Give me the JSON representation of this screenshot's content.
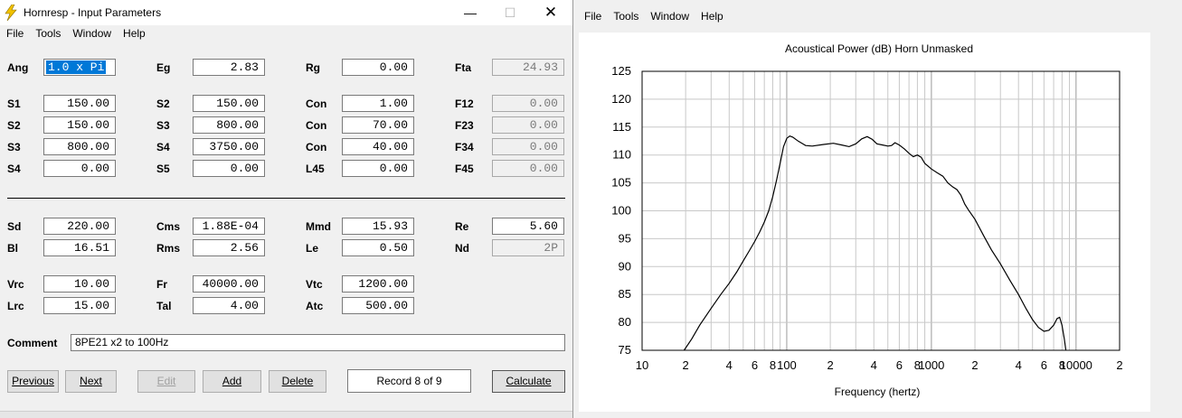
{
  "window": {
    "title": "Hornresp - Input Parameters",
    "minimize_glyph": "—",
    "maximize_glyph": "☐",
    "close_glyph": "✕"
  },
  "left_menu": [
    "File",
    "Tools",
    "Window",
    "Help"
  ],
  "right_menu": [
    "File",
    "Tools",
    "Window",
    "Help"
  ],
  "params": {
    "ang": {
      "label": "Ang",
      "value": "1.0 x Pi"
    },
    "eg": {
      "label": "Eg",
      "value": "2.83"
    },
    "rg": {
      "label": "Rg",
      "value": "0.00"
    },
    "fta": {
      "label": "Fta",
      "value": "24.93"
    },
    "s1": {
      "label": "S1",
      "value": "150.00"
    },
    "s2a": {
      "label": "S2",
      "value": "150.00"
    },
    "con1": {
      "label": "Con",
      "value": "1.00"
    },
    "f12": {
      "label": "F12",
      "value": "0.00"
    },
    "s2b": {
      "label": "S2",
      "value": "150.00"
    },
    "s3a": {
      "label": "S3",
      "value": "800.00"
    },
    "con2": {
      "label": "Con",
      "value": "70.00"
    },
    "f23": {
      "label": "F23",
      "value": "0.00"
    },
    "s3b": {
      "label": "S3",
      "value": "800.00"
    },
    "s4a": {
      "label": "S4",
      "value": "3750.00"
    },
    "con3": {
      "label": "Con",
      "value": "40.00"
    },
    "f34": {
      "label": "F34",
      "value": "0.00"
    },
    "s4b": {
      "label": "S4",
      "value": "0.00"
    },
    "s5": {
      "label": "S5",
      "value": "0.00"
    },
    "l45": {
      "label": "L45",
      "value": "0.00"
    },
    "f45": {
      "label": "F45",
      "value": "0.00"
    },
    "sd": {
      "label": "Sd",
      "value": "220.00"
    },
    "cms": {
      "label": "Cms",
      "value": "1.88E-04"
    },
    "mmd": {
      "label": "Mmd",
      "value": "15.93"
    },
    "re": {
      "label": "Re",
      "value": "5.60"
    },
    "bl": {
      "label": "Bl",
      "value": "16.51"
    },
    "rms": {
      "label": "Rms",
      "value": "2.56"
    },
    "le": {
      "label": "Le",
      "value": "0.50"
    },
    "nd": {
      "label": "Nd",
      "value": "2P"
    },
    "vrc": {
      "label": "Vrc",
      "value": "10.00"
    },
    "fr": {
      "label": "Fr",
      "value": "40000.00"
    },
    "vtc": {
      "label": "Vtc",
      "value": "1200.00"
    },
    "lrc": {
      "label": "Lrc",
      "value": "15.00"
    },
    "tal": {
      "label": "Tal",
      "value": "4.00"
    },
    "atc": {
      "label": "Atc",
      "value": "500.00"
    }
  },
  "comment": {
    "label": "Comment",
    "value": "8PE21 x2 to 100Hz"
  },
  "buttons": {
    "previous": "Previous",
    "next": "Next",
    "edit": "Edit",
    "add": "Add",
    "delete": "Delete",
    "calculate": "Calculate"
  },
  "record": "Record 8 of 9",
  "colors": {
    "selection": "#0078d7",
    "curve": "#000000",
    "grid": "#c8c8c8"
  },
  "chart_data": {
    "type": "line",
    "title": "Acoustical Power (dB)   Horn   Unmasked",
    "xlabel": "Frequency (hertz)",
    "ylabel": "",
    "xscale": "log",
    "xlim": [
      10,
      20000
    ],
    "ylim": [
      75,
      125
    ],
    "yticks": [
      75,
      80,
      85,
      90,
      95,
      100,
      105,
      110,
      115,
      120,
      125
    ],
    "xtick_labels": [
      {
        "v": 10,
        "t": "10"
      },
      {
        "v": 20,
        "t": "2"
      },
      {
        "v": 40,
        "t": "4"
      },
      {
        "v": 60,
        "t": "6"
      },
      {
        "v": 80,
        "t": "8"
      },
      {
        "v": 100,
        "t": "100"
      },
      {
        "v": 200,
        "t": "2"
      },
      {
        "v": 400,
        "t": "4"
      },
      {
        "v": 600,
        "t": "6"
      },
      {
        "v": 800,
        "t": "8"
      },
      {
        "v": 1000,
        "t": "1000"
      },
      {
        "v": 2000,
        "t": "2"
      },
      {
        "v": 4000,
        "t": "4"
      },
      {
        "v": 6000,
        "t": "6"
      },
      {
        "v": 8000,
        "t": "8"
      },
      {
        "v": 10000,
        "t": "10000"
      },
      {
        "v": 20000,
        "t": "2"
      }
    ],
    "grid": true,
    "series": [
      {
        "points": [
          [
            19.5,
            75
          ],
          [
            22,
            77
          ],
          [
            25,
            79.5
          ],
          [
            30,
            82.5
          ],
          [
            35,
            85
          ],
          [
            40,
            87
          ],
          [
            45,
            89
          ],
          [
            50,
            91
          ],
          [
            55,
            92.8
          ],
          [
            60,
            94.5
          ],
          [
            65,
            96.2
          ],
          [
            70,
            98
          ],
          [
            75,
            100
          ],
          [
            80,
            102.5
          ],
          [
            85,
            105.5
          ],
          [
            90,
            108.5
          ],
          [
            95,
            111.5
          ],
          [
            100,
            113
          ],
          [
            105,
            113.4
          ],
          [
            110,
            113.2
          ],
          [
            120,
            112.5
          ],
          [
            135,
            111.7
          ],
          [
            150,
            111.6
          ],
          [
            180,
            111.9
          ],
          [
            210,
            112.1
          ],
          [
            240,
            111.8
          ],
          [
            270,
            111.5
          ],
          [
            300,
            112
          ],
          [
            330,
            112.9
          ],
          [
            360,
            113.3
          ],
          [
            390,
            112.8
          ],
          [
            420,
            112
          ],
          [
            460,
            111.8
          ],
          [
            500,
            111.6
          ],
          [
            530,
            111.7
          ],
          [
            560,
            112.2
          ],
          [
            600,
            111.8
          ],
          [
            650,
            111.1
          ],
          [
            700,
            110.3
          ],
          [
            750,
            109.7
          ],
          [
            800,
            110
          ],
          [
            850,
            109.6
          ],
          [
            900,
            108.5
          ],
          [
            1000,
            107.5
          ],
          [
            1100,
            106.8
          ],
          [
            1200,
            106.2
          ],
          [
            1300,
            105
          ],
          [
            1400,
            104.3
          ],
          [
            1500,
            103.8
          ],
          [
            1600,
            102.8
          ],
          [
            1700,
            101.2
          ],
          [
            1800,
            100.2
          ],
          [
            2000,
            98.5
          ],
          [
            2300,
            95.5
          ],
          [
            2600,
            93
          ],
          [
            3000,
            90.5
          ],
          [
            3500,
            87.5
          ],
          [
            4000,
            85
          ],
          [
            4500,
            82.5
          ],
          [
            5000,
            80.5
          ],
          [
            5500,
            79.1
          ],
          [
            6000,
            78.4
          ],
          [
            6500,
            78.6
          ],
          [
            7000,
            79.5
          ],
          [
            7400,
            80.7
          ],
          [
            7700,
            80.9
          ],
          [
            8000,
            79.5
          ],
          [
            8300,
            77
          ],
          [
            8500,
            75
          ]
        ]
      }
    ]
  }
}
